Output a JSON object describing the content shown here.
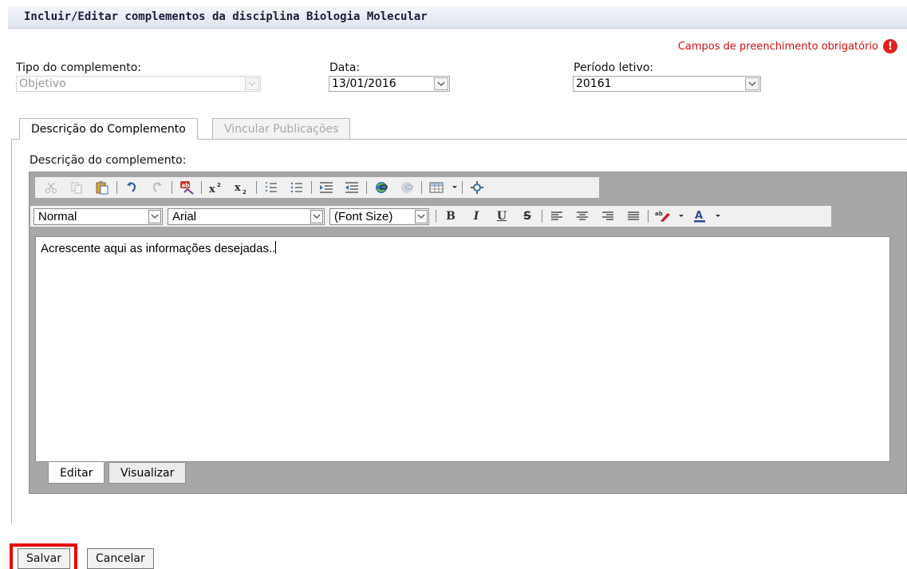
{
  "dialog": {
    "title": "Incluir/Editar complementos da disciplina Biologia Molecular",
    "required_note": "Campos de preenchimento obrigatório",
    "required_icon": "exclamation-icon"
  },
  "fields": {
    "tipo": {
      "label": "Tipo do complemento:",
      "value": "Objetivo",
      "disabled": true
    },
    "data": {
      "label": "Data:",
      "value": "13/01/2016"
    },
    "periodo": {
      "label": "Período letivo:",
      "value": "20161"
    }
  },
  "tabs": [
    {
      "label": "Descrição do Complemento",
      "active": true
    },
    {
      "label": "Vincular Publicações",
      "active": false
    }
  ],
  "editor": {
    "label": "Descrição do complemento:",
    "toolbar_row1": [
      "cut-icon",
      "copy-icon",
      "paste-icon",
      "undo-icon",
      "redo-icon",
      "spellcheck-icon",
      "superscript-icon",
      "subscript-icon",
      "ordered-list-icon",
      "unordered-list-icon",
      "indent-icon",
      "outdent-icon",
      "link-icon",
      "unlink-icon",
      "table-icon",
      "fullscreen-icon"
    ],
    "toolbar_row2": [
      "bold-icon",
      "italic-icon",
      "underline-icon",
      "strikethrough-icon",
      "align-left-icon",
      "align-center-icon",
      "align-right-icon",
      "justify-icon",
      "highlight-icon",
      "text-color-icon"
    ],
    "format_select": "Normal",
    "font_select": "Arial",
    "size_select": "(Font Size)",
    "content": "Acrescente aqui as informações desejadas..",
    "mode_tabs": [
      {
        "label": "Editar",
        "active": true
      },
      {
        "label": "Visualizar",
        "active": false
      }
    ]
  },
  "actions": {
    "save_label": "Salvar",
    "cancel_label": "Cancelar"
  },
  "colors": {
    "required_red": "#cc1010",
    "highlight_red": "#e60000",
    "editor_frame": "#a7a7a7"
  }
}
